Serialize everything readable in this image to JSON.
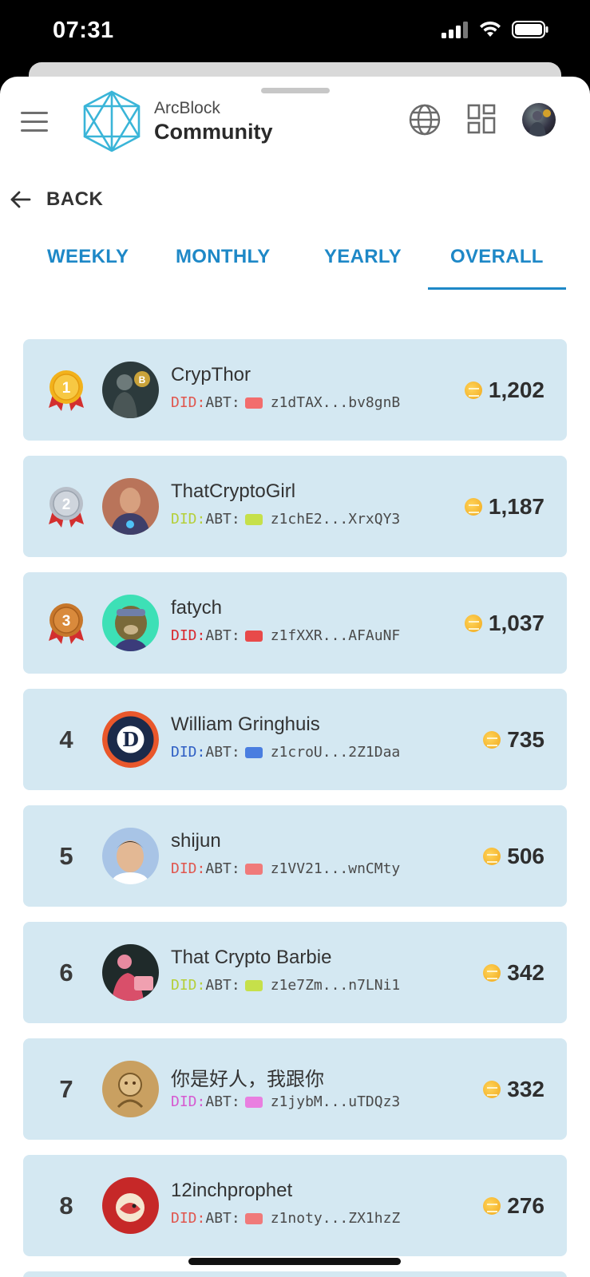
{
  "status": {
    "time": "07:31"
  },
  "header": {
    "brand_top": "ArcBlock",
    "brand_bottom": "Community"
  },
  "nav": {
    "back_label": "BACK"
  },
  "tabs": [
    {
      "label": "WEEKLY",
      "active": false
    },
    {
      "label": "MONTHLY",
      "active": false
    },
    {
      "label": "YEARLY",
      "active": false
    },
    {
      "label": "OVERALL",
      "active": true
    }
  ],
  "colors": {
    "accent": "#1e88c7",
    "row_bg": "#d4e8f2",
    "gold": "#f2b21c",
    "silver": "#b8bfc9",
    "bronze": "#c7772b"
  },
  "leaderboard": [
    {
      "rank": "1",
      "medal": "gold",
      "name": "CrypThor",
      "did_prefix": "DID:",
      "did_prefix_color": "#e0564e",
      "did_type": "ABT:",
      "chip_color": "#f26d6d",
      "did": "z1dTAX...bv8gnB",
      "score": "1,202"
    },
    {
      "rank": "2",
      "medal": "silver",
      "name": "ThatCryptoGirl",
      "did_prefix": "DID:",
      "did_prefix_color": "#b5cf3a",
      "did_type": "ABT:",
      "chip_color": "#c6e04a",
      "did": "z1chE2...XrxQY3",
      "score": "1,187"
    },
    {
      "rank": "3",
      "medal": "bronze",
      "name": "fatych",
      "did_prefix": "DID:",
      "did_prefix_color": "#d9282e",
      "did_type": "ABT:",
      "chip_color": "#e84a4a",
      "did": "z1fXXR...AFAuNF",
      "score": "1,037"
    },
    {
      "rank": "4",
      "medal": "",
      "name": "William Gringhuis",
      "did_prefix": "DID:",
      "did_prefix_color": "#2f5fc4",
      "did_type": "ABT:",
      "chip_color": "#4a7ee0",
      "did": "z1croU...2Z1Daa",
      "score": "735"
    },
    {
      "rank": "5",
      "medal": "",
      "name": "shijun",
      "did_prefix": "DID:",
      "did_prefix_color": "#e0564e",
      "did_type": "ABT:",
      "chip_color": "#f07a7a",
      "did": "z1VV21...wnCMty",
      "score": "506"
    },
    {
      "rank": "6",
      "medal": "",
      "name": "That Crypto Barbie",
      "did_prefix": "DID:",
      "did_prefix_color": "#b5cf3a",
      "did_type": "ABT:",
      "chip_color": "#c6e04a",
      "did": "z1e7Zm...n7LNi1",
      "score": "342"
    },
    {
      "rank": "7",
      "medal": "",
      "name": "你是好人，我跟你",
      "did_prefix": "DID:",
      "did_prefix_color": "#d65ad0",
      "did_type": "ABT:",
      "chip_color": "#e97fe0",
      "did": "z1jybM...uTDQz3",
      "score": "332"
    },
    {
      "rank": "8",
      "medal": "",
      "name": "12inchprophet",
      "did_prefix": "DID:",
      "did_prefix_color": "#e0564e",
      "did_type": "ABT:",
      "chip_color": "#f07a7a",
      "did": "z1noty...ZX1hzZ",
      "score": "276"
    }
  ]
}
